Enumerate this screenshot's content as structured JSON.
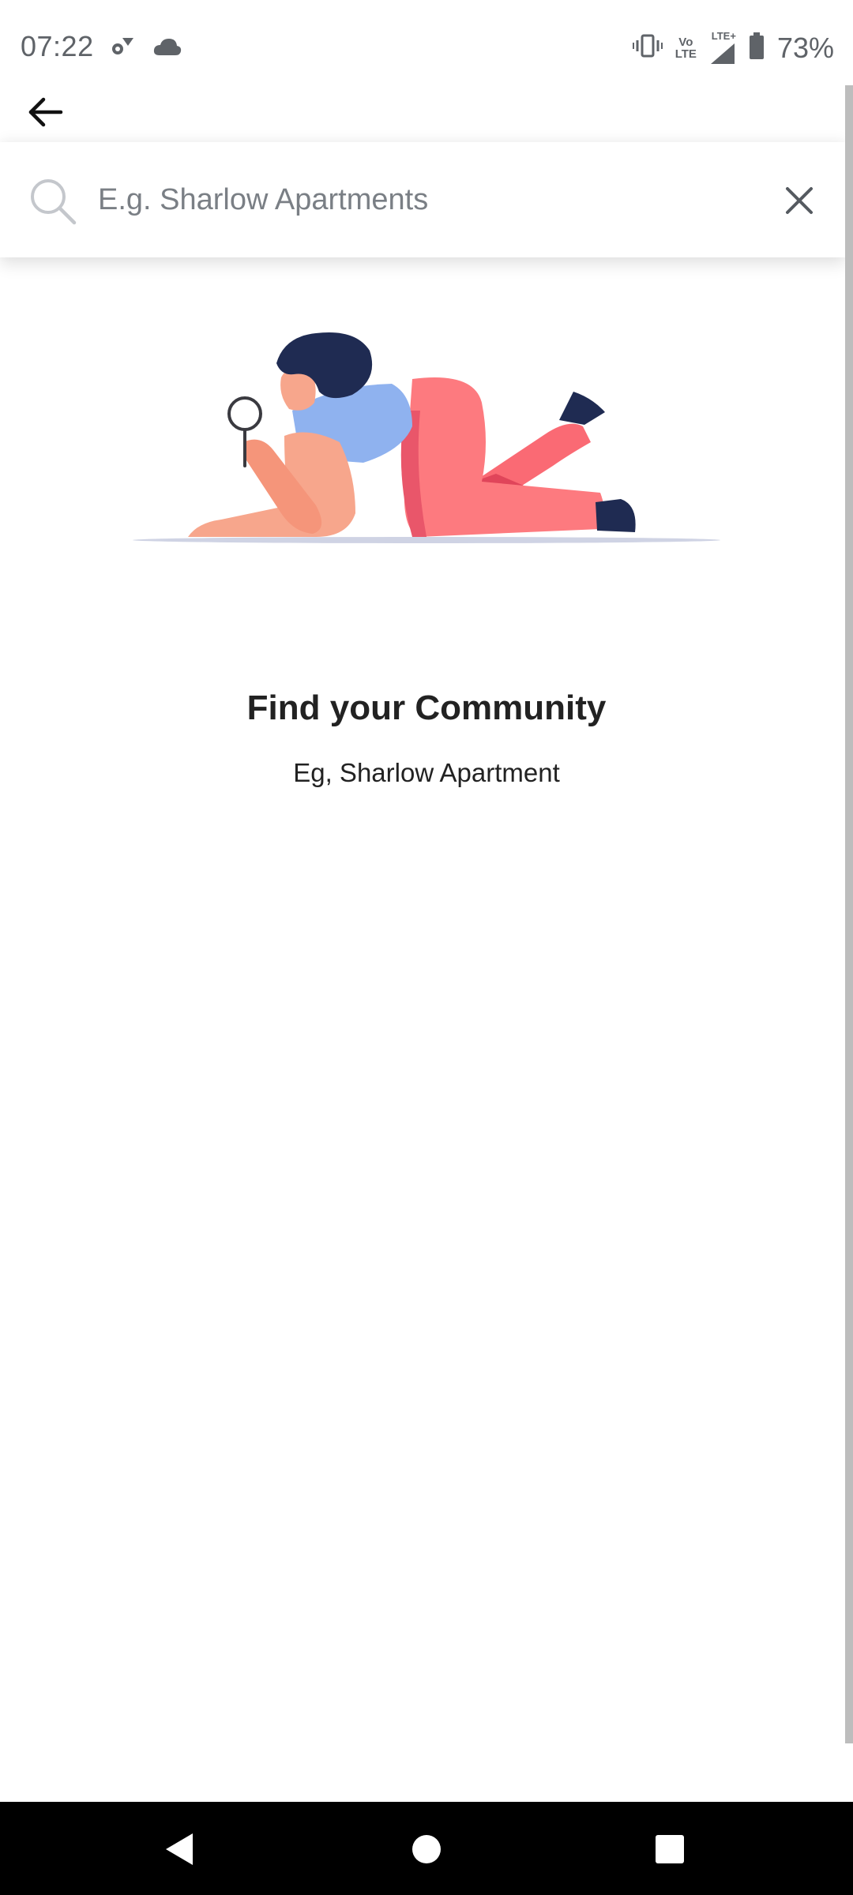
{
  "status_bar": {
    "time": "07:22",
    "battery": "73%",
    "lte_top": "Vo",
    "lte_bottom": "LTE",
    "lte_plus": "LTE+",
    "icons": [
      "settings-gear-icon",
      "cloud-icon",
      "vibrate-icon",
      "volte-icon",
      "signal-icon",
      "battery-icon"
    ]
  },
  "search": {
    "placeholder": "E.g. Sharlow Apartments",
    "value": ""
  },
  "empty_state": {
    "title": "Find your Community",
    "subtitle": "Eg, Sharlow Apartment"
  },
  "colors": {
    "accent_pink": "#fd7a7f",
    "shirt_blue": "#8fb2ef",
    "hair_navy": "#1f2b52",
    "skin": "#f7a68c"
  }
}
